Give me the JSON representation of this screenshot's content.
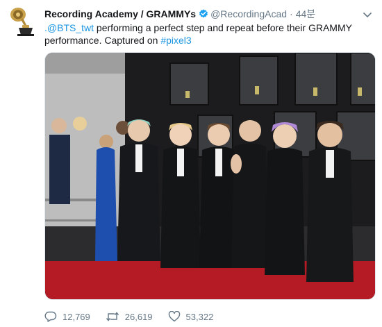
{
  "tweet": {
    "author_name": "Recording Academy / GRAMMYs",
    "handle": "@RecordingAcad",
    "separator": "·",
    "timestamp": "44분",
    "text_mention": ".@BTS_twt",
    "text_body": " performing a perfect step and repeat before their GRAMMY performance. Captured on ",
    "text_hashtag": "#pixel3",
    "icons": {
      "avatar": "grammy-gramophone-icon",
      "verified": "verified-badge-icon",
      "menu": "chevron-down-icon",
      "reply": "reply-icon",
      "retweet": "retweet-icon",
      "like": "heart-icon"
    },
    "colors": {
      "link": "#1b95e0",
      "verified": "#1da1f2",
      "muted": "#657786"
    }
  },
  "actions": {
    "replies": "12,769",
    "retweets": "26,619",
    "likes": "53,322"
  }
}
